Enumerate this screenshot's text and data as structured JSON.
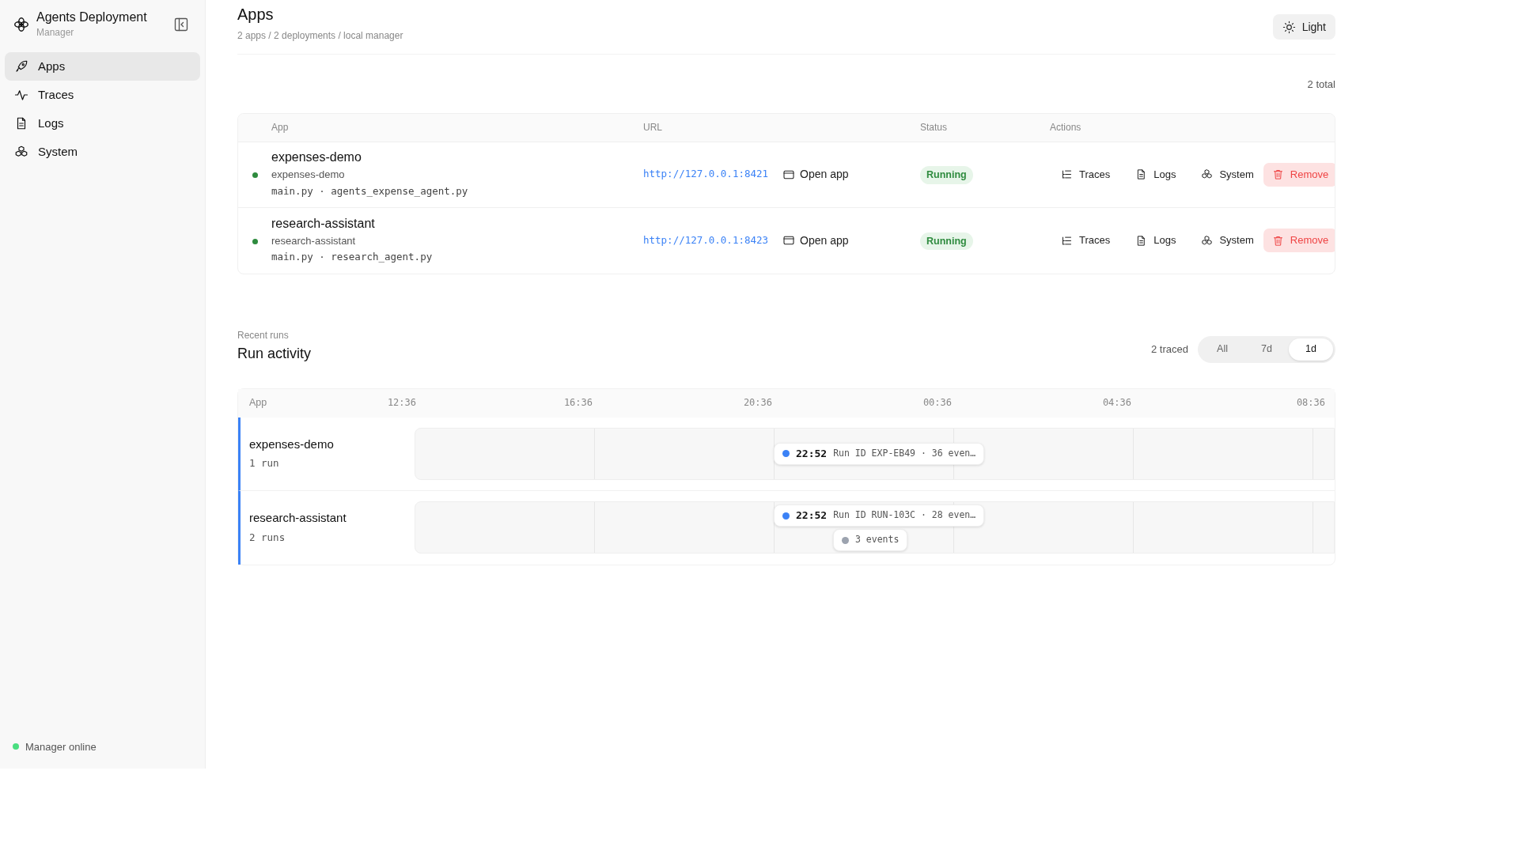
{
  "sidebar": {
    "title": "Agents Deployment",
    "subtitle": "Manager",
    "items": [
      {
        "label": "Apps",
        "selected": true
      },
      {
        "label": "Traces",
        "selected": false
      },
      {
        "label": "Logs",
        "selected": false
      },
      {
        "label": "System",
        "selected": false
      }
    ],
    "status": {
      "label": "Manager online",
      "color": "#4ade80"
    }
  },
  "header": {
    "title": "Apps",
    "subtitle": "2 apps / 2 deployments / local manager",
    "theme_button": "Light"
  },
  "apps": {
    "count": "2 total",
    "columns": [
      "App",
      "URL",
      "Status",
      "Actions"
    ],
    "rows": [
      {
        "name": "expenses-demo",
        "deployment": "expenses-demo",
        "files": "main.py · agents_expense_agent.py",
        "url": "http://127.0.0.1:8421",
        "open_label": "Open app",
        "status": "Running",
        "actions": [
          "Traces",
          "Logs",
          "System"
        ],
        "remove": "Remove"
      },
      {
        "name": "research-assistant",
        "deployment": "research-assistant",
        "files": "main.py · research_agent.py",
        "url": "http://127.0.0.1:8423",
        "open_label": "Open app",
        "status": "Running",
        "actions": [
          "Traces",
          "Logs",
          "System"
        ],
        "remove": "Remove"
      }
    ]
  },
  "activity": {
    "eyebrow": "Recent runs",
    "title": "Run activity",
    "traced": "2 traced",
    "ranges": [
      {
        "label": "All",
        "selected": false
      },
      {
        "label": "7d",
        "selected": false
      },
      {
        "label": "1d",
        "selected": true
      }
    ],
    "column": "App",
    "ticks": [
      "12:36",
      "16:36",
      "20:36",
      "00:36",
      "04:36",
      "08:36"
    ],
    "rows": [
      {
        "name": "expenses-demo",
        "runs_label": "1 run",
        "runs": [
          {
            "time": "22:52",
            "label": "Run ID EXP-EB49 · 36 even…",
            "color": "#3b82f6"
          }
        ]
      },
      {
        "name": "research-assistant",
        "runs_label": "2 runs",
        "runs": [
          {
            "time": "22:52",
            "label": "Run ID RUN-103C · 28 even…",
            "color": "#3b82f6"
          },
          {
            "label": "3 events",
            "color": "#9ca3af"
          }
        ]
      }
    ]
  }
}
